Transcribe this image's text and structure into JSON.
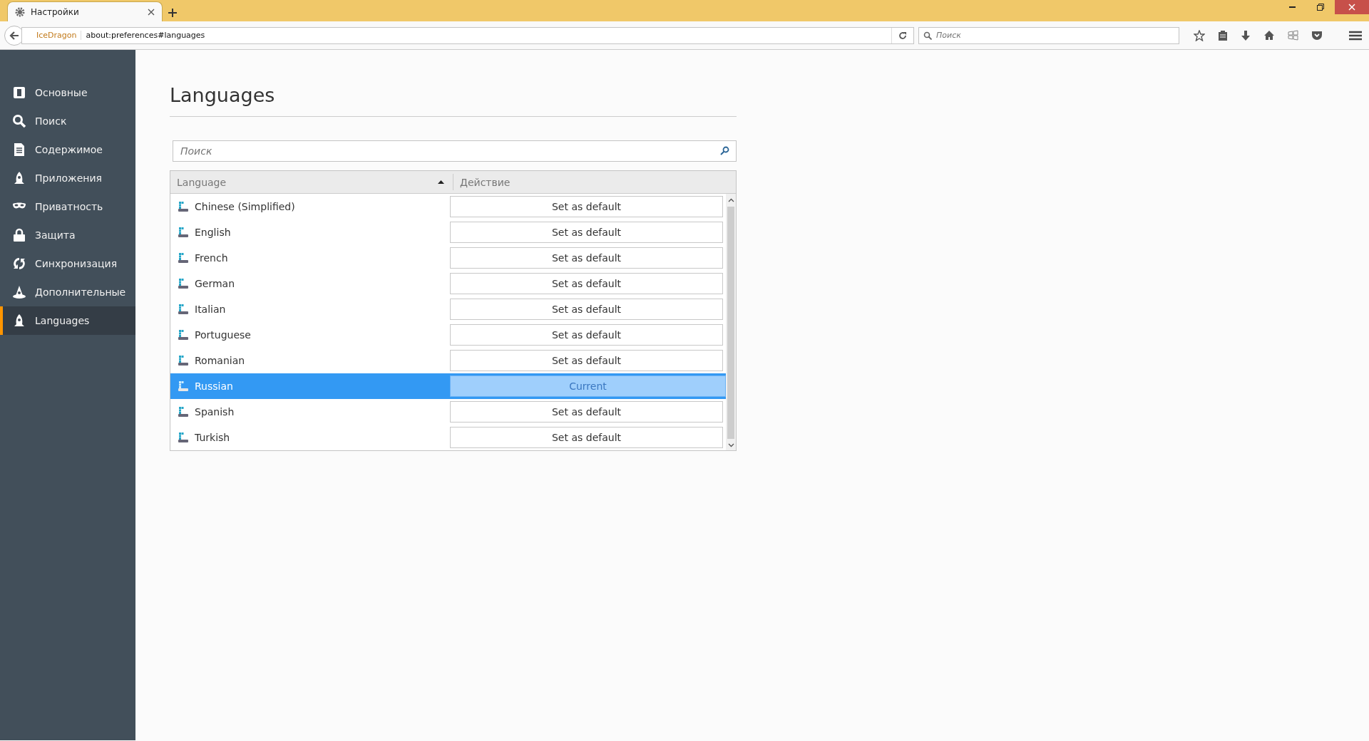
{
  "tab": {
    "title": "Настройки"
  },
  "toolbar": {
    "brand": "IceDragon",
    "url": "about:preferences#languages",
    "search": {
      "placeholder": "Поиск"
    }
  },
  "sidebar": {
    "items": [
      {
        "label": "Основные",
        "selected": false
      },
      {
        "label": "Поиск",
        "selected": false
      },
      {
        "label": "Содержимое",
        "selected": false
      },
      {
        "label": "Приложения",
        "selected": false
      },
      {
        "label": "Приватность",
        "selected": false
      },
      {
        "label": "Защита",
        "selected": false
      },
      {
        "label": "Синхронизация",
        "selected": false
      },
      {
        "label": "Дополнительные",
        "selected": false
      },
      {
        "label": "Languages",
        "selected": true
      }
    ]
  },
  "page": {
    "title": "Languages",
    "search": {
      "placeholder": "Поиск"
    }
  },
  "table": {
    "columns": [
      {
        "label": "Language",
        "sorted": true
      },
      {
        "label": "Действие",
        "sorted": false
      }
    ],
    "rows": [
      {
        "language": "Chinese (Simplified)",
        "action": "Set as default",
        "selected": false
      },
      {
        "language": "English",
        "action": "Set as default",
        "selected": false
      },
      {
        "language": "French",
        "action": "Set as default",
        "selected": false
      },
      {
        "language": "German",
        "action": "Set as default",
        "selected": false
      },
      {
        "language": "Italian",
        "action": "Set as default",
        "selected": false
      },
      {
        "language": "Portuguese",
        "action": "Set as default",
        "selected": false
      },
      {
        "language": "Romanian",
        "action": "Set as default",
        "selected": false
      },
      {
        "language": "Russian",
        "action": "Current",
        "selected": true
      },
      {
        "language": "Spanish",
        "action": "Set as default",
        "selected": false
      },
      {
        "language": "Turkish",
        "action": "Set as default",
        "selected": false
      }
    ]
  }
}
